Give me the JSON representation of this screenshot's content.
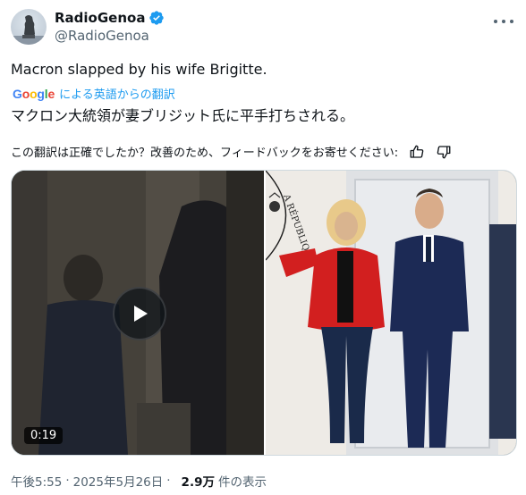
{
  "author": {
    "name": "RadioGenoa",
    "handle": "@RadioGenoa",
    "verified": true,
    "verified_color": "#1d9bf0"
  },
  "menu": {
    "icon": "more-horizontal-icon"
  },
  "tweet": {
    "text": "Macron slapped by his wife Brigitte.",
    "translation_label": "による英語からの翻訳",
    "translation_provider": "Google",
    "translated_text": "マクロン大統領が妻ブリジット氏に平手打ちされる。",
    "feedback_question": "この翻訳は正確でしたか？改善のため、フィードバックをお寄せください:"
  },
  "media": {
    "video": {
      "duration": "0:19",
      "icon": "play-icon"
    },
    "photo": {
      "seal_text": "A RÉPUBLIQUE"
    }
  },
  "meta": {
    "time": "午後5:55",
    "date": "2025年5月26日",
    "views": "2.9万",
    "views_label": "件の表示"
  },
  "colors": {
    "text": "#0f1419",
    "secondary": "#536471",
    "link": "#1d9bf0",
    "border": "#cfd9de"
  }
}
